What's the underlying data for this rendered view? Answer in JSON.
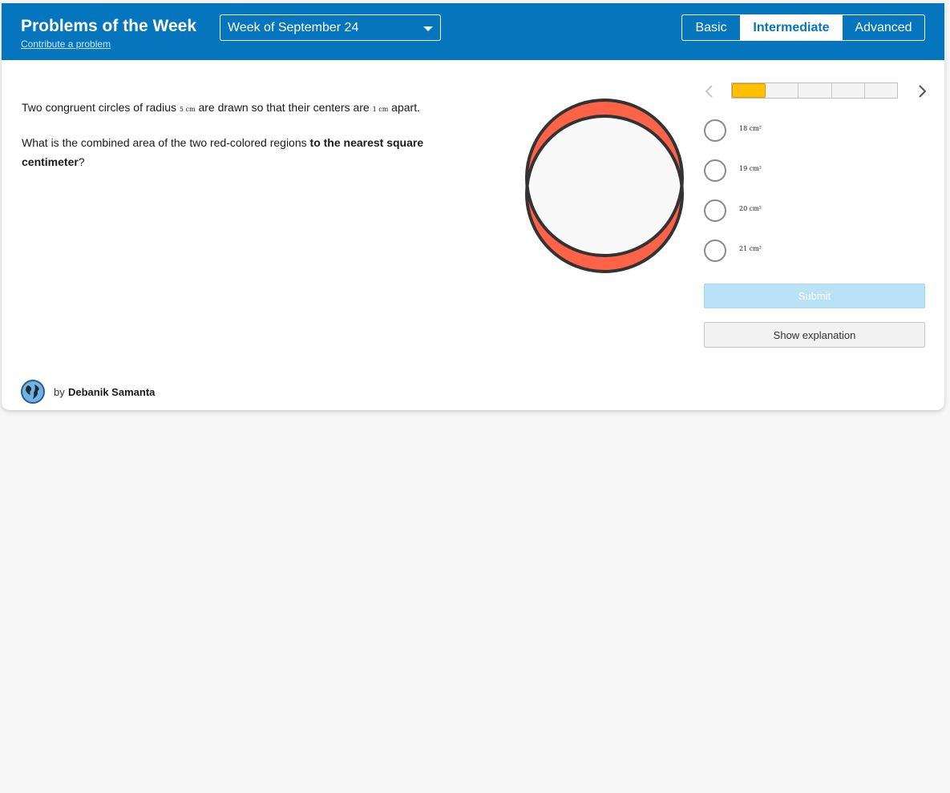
{
  "header": {
    "title": "Problems of the Week",
    "contribute_link": "Contribute a problem",
    "week_selected": "Week of September 24",
    "levels": [
      "Basic",
      "Intermediate",
      "Advanced"
    ],
    "active_level": "Intermediate"
  },
  "problem": {
    "line1_a": "Two congruent circles of radius ",
    "radius": "5 cm",
    "line1_b": " are drawn so that their centers are ",
    "distance": "1 cm",
    "line1_c": " apart.",
    "line2_a": "What is the combined area of the two red-colored regions ",
    "line2_bold": "to the nearest square centimeter",
    "line2_c": "?"
  },
  "progress": {
    "segments": 5,
    "current": 1
  },
  "choices": [
    "18 cm²",
    "19 cm²",
    "20 cm²",
    "21 cm²"
  ],
  "buttons": {
    "submit": "Submit",
    "explain": "Show explanation"
  },
  "author": {
    "prefix": "by",
    "name": "Debanik Samanta"
  },
  "colors": {
    "header_blue": "#0576be",
    "region_red": "#ff6347",
    "progress_current": "#ffc000"
  }
}
